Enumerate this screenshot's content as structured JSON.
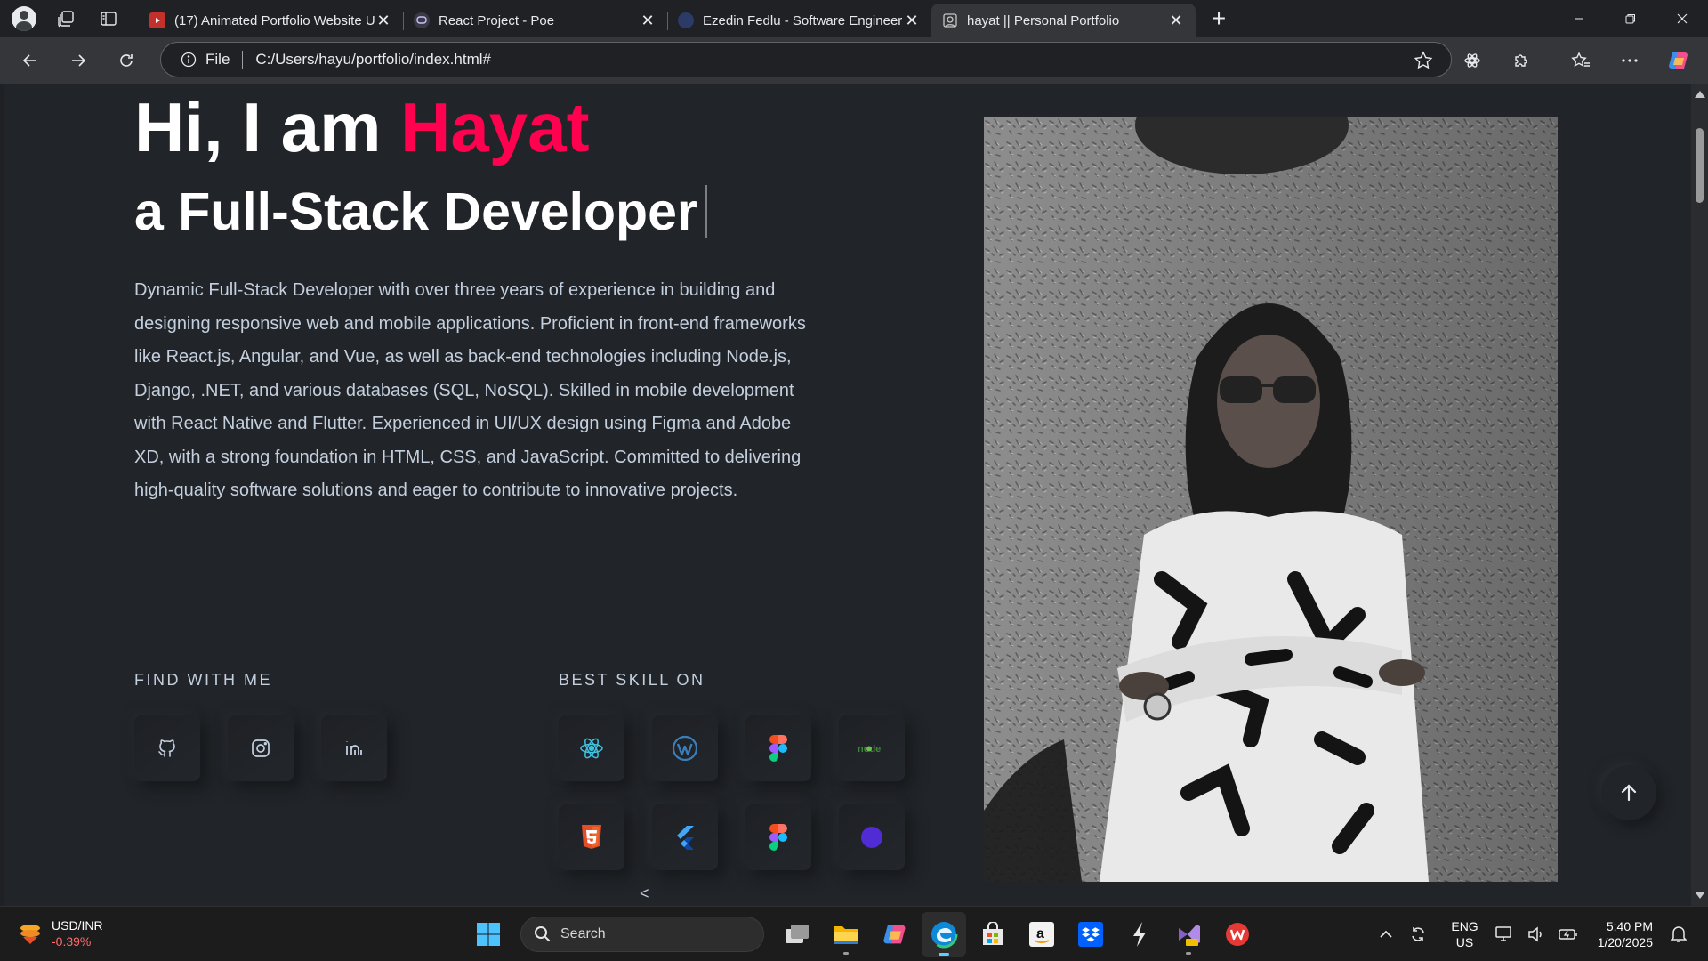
{
  "browser": {
    "tabs": [
      {
        "title": "(17) Animated Portfolio Website U",
        "favicon": "youtube-icon",
        "active": false
      },
      {
        "title": "React Project - Poe",
        "favicon": "poe-icon",
        "active": false
      },
      {
        "title": "Ezedin Fedlu - Software Engineer",
        "favicon": "globe-icon",
        "active": false
      },
      {
        "title": "hayat || Personal Portfolio",
        "favicon": "page-icon",
        "active": true
      }
    ],
    "omnibox": {
      "scheme_label": "File",
      "url": "C:/Users/hayu/portfolio/index.html#"
    }
  },
  "hero": {
    "greeting": "Hi, I am ",
    "name": "Hayat",
    "role": "a Full-Stack Developer",
    "description": "Dynamic Full-Stack Developer with over three years of experience in building and designing responsive web and mobile applications. Proficient in front-end frameworks like React.js, Angular, and Vue, as well as back-end technologies including Node.js, Django, .NET, and various databases (SQL, NoSQL). Skilled in mobile development with React Native and Flutter. Experienced in UI/UX design using Figma and Adobe XD, with a strong foundation in HTML, CSS, and JavaScript. Committed to delivering high-quality software solutions and eager to contribute to innovative projects."
  },
  "find_with_me": {
    "label": "FIND WITH ME",
    "links": [
      "github-icon",
      "instagram-icon",
      "linkedin-icon"
    ]
  },
  "best_skill_on": {
    "label": "BEST SKILL ON",
    "skills": [
      "react-icon",
      "wordpress-icon",
      "figma-icon",
      "node-icon",
      "html5-icon",
      "flutter-icon",
      "figma-icon",
      "dotnet-icon"
    ],
    "more_indicator": "<"
  },
  "colors": {
    "accent": "#ff014f",
    "page_bg": "#212428",
    "body_text": "#c4cfde"
  },
  "taskbar": {
    "ticker": {
      "name": "USD/INR",
      "change": "-0.39%"
    },
    "search_placeholder": "Search",
    "apps": [
      "task-view-icon",
      "file-explorer-icon",
      "copilot-icon",
      "edge-icon",
      "microsoft-store-icon",
      "amazon-icon",
      "dropbox-icon",
      "bolt-icon",
      "visual-studio-icon",
      "wps-office-icon"
    ],
    "language": {
      "line1": "ENG",
      "line2": "US"
    },
    "clock": {
      "time": "5:40 PM",
      "date": "1/20/2025"
    }
  }
}
